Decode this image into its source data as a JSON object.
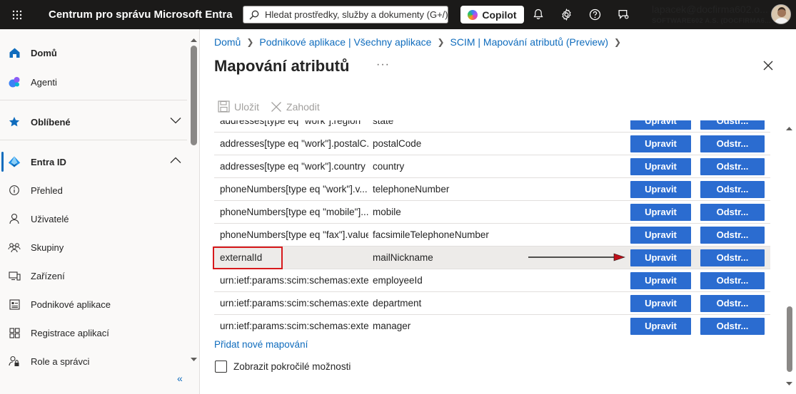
{
  "topbar": {
    "app_title": "Centrum pro správu Microsoft Entra",
    "search_placeholder": "Hledat prostředky, služby a dokumenty (G+/)",
    "copilot_label": "Copilot",
    "user_email": "lapacek@docfirma602.o...",
    "user_org": "SOFTWARE602 A.S. (DOCFIRMA6...",
    "icons": [
      "waffle-icon",
      "search-icon",
      "bell-icon",
      "gear-icon",
      "help-icon",
      "feedback-icon"
    ]
  },
  "sidebar": {
    "home": "Domů",
    "agents": "Agenti",
    "favorites": "Oblíbené",
    "entra_id": "Entra ID",
    "items": [
      {
        "label": "Přehled",
        "icon": "info-icon"
      },
      {
        "label": "Uživatelé",
        "icon": "user-icon"
      },
      {
        "label": "Skupiny",
        "icon": "group-icon"
      },
      {
        "label": "Zařízení",
        "icon": "device-icon"
      },
      {
        "label": "Podnikové aplikace",
        "icon": "enterprise-apps-icon"
      },
      {
        "label": "Registrace aplikací",
        "icon": "app-registration-icon"
      },
      {
        "label": "Role a správci",
        "icon": "roles-icon"
      }
    ],
    "collapse": "«"
  },
  "breadcrumb": [
    "Domů",
    "Podnikové aplikace | Všechny aplikace",
    "SCIM | Mapování atributů (Preview)"
  ],
  "page": {
    "title": "Mapování atributů",
    "more": "···"
  },
  "toolbar": {
    "save": "Uložit",
    "discard": "Zahodit"
  },
  "mappings": [
    {
      "source": "addresses[type eq \"work\"].region",
      "target": "state",
      "edit": "Upravit",
      "delete": "Odstr..."
    },
    {
      "source": "addresses[type eq \"work\"].postalC...",
      "target": "postalCode",
      "edit": "Upravit",
      "delete": "Odstr..."
    },
    {
      "source": "addresses[type eq \"work\"].country",
      "target": "country",
      "edit": "Upravit",
      "delete": "Odstr..."
    },
    {
      "source": "phoneNumbers[type eq \"work\"].v...",
      "target": "telephoneNumber",
      "edit": "Upravit",
      "delete": "Odstr..."
    },
    {
      "source": "phoneNumbers[type eq \"mobile\"]...",
      "target": "mobile",
      "edit": "Upravit",
      "delete": "Odstr..."
    },
    {
      "source": "phoneNumbers[type eq \"fax\"].value",
      "target": "facsimileTelephoneNumber",
      "edit": "Upravit",
      "delete": "Odstr..."
    },
    {
      "source": "externalId",
      "target": "mailNickname",
      "edit": "Upravit",
      "delete": "Odstr..."
    },
    {
      "source": "urn:ietf:params:scim:schemas:exte...",
      "target": "employeeId",
      "edit": "Upravit",
      "delete": "Odstr..."
    },
    {
      "source": "urn:ietf:params:scim:schemas:exte...",
      "target": "department",
      "edit": "Upravit",
      "delete": "Odstr..."
    },
    {
      "source": "urn:ietf:params:scim:schemas:exte...",
      "target": "manager",
      "edit": "Upravit",
      "delete": "Odstr..."
    }
  ],
  "add_mapping": "Přidat nové mapování",
  "advanced_options": "Zobrazit pokročilé možnosti",
  "colors": {
    "accent": "#0f6cbd",
    "button": "#2b6cd0",
    "highlight_box": "#d7191c",
    "topbar": "#1b1a19"
  }
}
